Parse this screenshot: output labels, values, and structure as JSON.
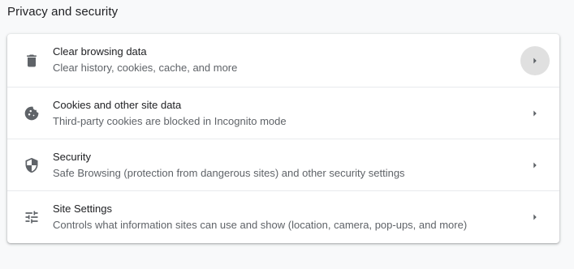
{
  "section": {
    "title": "Privacy and security"
  },
  "rows": [
    {
      "label": "Clear browsing data",
      "sublabel": "Clear history, cookies, cache, and more",
      "icon": "trash-icon"
    },
    {
      "label": "Cookies and other site data",
      "sublabel": "Third-party cookies are blocked in Incognito mode",
      "icon": "cookie-icon"
    },
    {
      "label": "Security",
      "sublabel": "Safe Browsing (protection from dangerous sites) and other security settings",
      "icon": "shield-icon"
    },
    {
      "label": "Site Settings",
      "sublabel": "Controls what information sites can use and show (location, camera, pop-ups, and more)",
      "icon": "tune-icon"
    }
  ],
  "colors": {
    "background": "#f8f9fa",
    "card": "#ffffff",
    "primary_text": "#202124",
    "secondary_text": "#5f6368",
    "hover_circle": "#e0e0e0"
  }
}
